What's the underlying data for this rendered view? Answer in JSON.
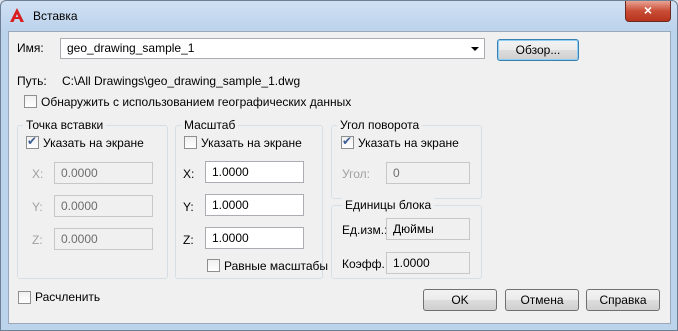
{
  "window": {
    "title": "Вставка",
    "close_glyph": "×"
  },
  "name_row": {
    "label": "Имя:",
    "value": "geo_drawing_sample_1",
    "browse_label": "Обзор..."
  },
  "path_row": {
    "label": "Путь:",
    "value": "C:\\All Drawings\\geo_drawing_sample_1.dwg"
  },
  "geo_checkbox": {
    "label": "Обнаружить с использованием географических данных",
    "checked": false
  },
  "insertion_point": {
    "title": "Точка вставки",
    "specify_label": "Указать на экране",
    "specify_checked": true,
    "x_label": "X:",
    "x_value": "0.0000",
    "y_label": "Y:",
    "y_value": "0.0000",
    "z_label": "Z:",
    "z_value": "0.0000"
  },
  "scale": {
    "title": "Масштаб",
    "specify_label": "Указать на экране",
    "specify_checked": false,
    "x_label": "X:",
    "x_value": "1.0000",
    "y_label": "Y:",
    "y_value": "1.0000",
    "z_label": "Z:",
    "z_value": "1.0000",
    "uniform_label": "Равные масштабы",
    "uniform_checked": false
  },
  "rotation": {
    "title": "Угол поворота",
    "specify_label": "Указать на экране",
    "specify_checked": true,
    "angle_label": "Угол:",
    "angle_value": "0"
  },
  "block_units": {
    "title": "Единицы блока",
    "unit_label": "Ед.изм.:",
    "unit_value": "Дюймы",
    "factor_label": "Коэфф.:",
    "factor_value": "1.0000"
  },
  "explode": {
    "label": "Расчленить",
    "checked": false
  },
  "buttons": {
    "ok": "OK",
    "cancel": "Отмена",
    "help": "Справка"
  },
  "colors": {
    "accent": "#3c7fb1",
    "close": "#c94d36",
    "app_icon": "#d81e1e"
  }
}
